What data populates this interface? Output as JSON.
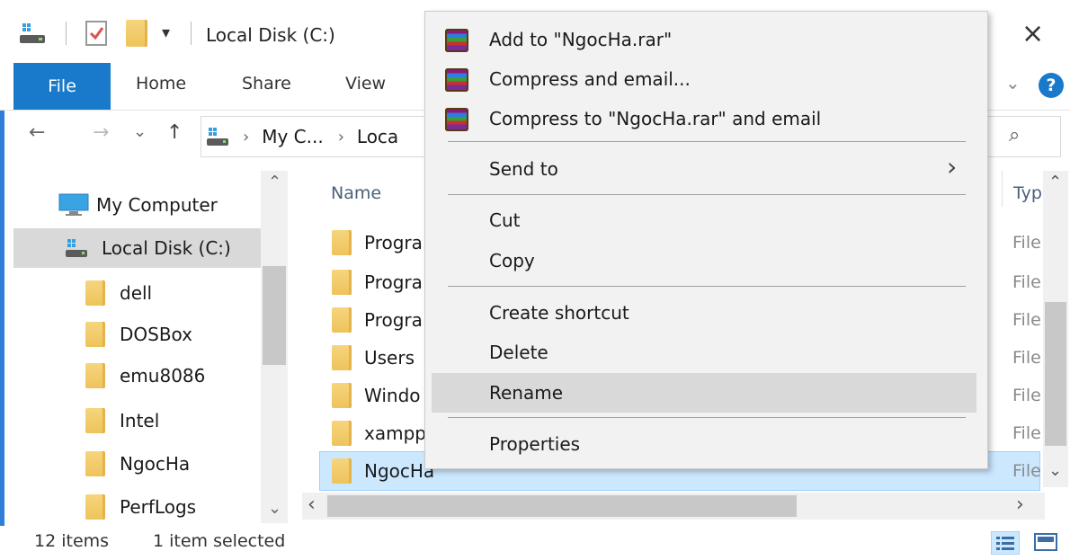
{
  "window": {
    "title": "Local Disk (C:)",
    "close_glyph": "×",
    "qat_dropdown_glyph": "▾"
  },
  "ribbon": {
    "tabs": [
      "File",
      "Home",
      "Share",
      "View"
    ],
    "expand_glyph": "⌄",
    "help_glyph": "?"
  },
  "address": {
    "back_glyph": "←",
    "forward_glyph": "→",
    "recent_glyph": "⌄",
    "up_glyph": "↑",
    "crumbs": [
      "My C...",
      "Loca"
    ],
    "crumb_sep": "›",
    "search_glyph": "⌕"
  },
  "nav_pane": {
    "items": [
      {
        "label": "My Computer",
        "icon": "computer-icon"
      },
      {
        "label": "Local Disk (C:)",
        "icon": "drive-icon",
        "selected": true
      },
      {
        "label": "dell",
        "icon": "folder-icon"
      },
      {
        "label": "DOSBox",
        "icon": "folder-icon"
      },
      {
        "label": "emu8086",
        "icon": "folder-icon"
      },
      {
        "label": "Intel",
        "icon": "folder-icon"
      },
      {
        "label": "NgocHa",
        "icon": "folder-icon"
      },
      {
        "label": "PerfLogs",
        "icon": "folder-icon"
      }
    ],
    "scroll_up_glyph": "⌃",
    "scroll_down_glyph": "⌄"
  },
  "file_list": {
    "column_name": "Name",
    "column_type": "Typ",
    "rows": [
      {
        "name": "Progra",
        "type": "File"
      },
      {
        "name": "Progra",
        "type": "File"
      },
      {
        "name": "Progra",
        "type": "File"
      },
      {
        "name": "Users",
        "type": "File"
      },
      {
        "name": "Windo",
        "type": "File"
      },
      {
        "name": "xampp",
        "type": "File"
      },
      {
        "name": "NgocHa",
        "type": "File",
        "selected": true
      }
    ],
    "hscroll_left_glyph": "‹",
    "hscroll_right_glyph": "›",
    "vscroll_up_glyph": "⌃",
    "vscroll_down_glyph": "⌄"
  },
  "context_menu": {
    "items": [
      {
        "label": "Add to \"NgocHa.rar\"",
        "icon": "winrar-icon"
      },
      {
        "label": "Compress and email...",
        "icon": "winrar-icon"
      },
      {
        "label": "Compress to \"NgocHa.rar\" and email",
        "icon": "winrar-icon"
      },
      {
        "label": "Send to",
        "submenu": true
      },
      {
        "label": "Cut"
      },
      {
        "label": "Copy"
      },
      {
        "label": "Create shortcut"
      },
      {
        "label": "Delete"
      },
      {
        "label": "Rename",
        "hover": true
      },
      {
        "label": "Properties"
      }
    ],
    "submenu_glyph": "›"
  },
  "status_bar": {
    "item_count": "12 items",
    "selection": "1 item selected"
  },
  "colors": {
    "accent": "#1979ca",
    "selection_bg": "#cce8ff",
    "menu_bg": "#f2f2f2",
    "menu_hover": "#d9d9d9"
  }
}
